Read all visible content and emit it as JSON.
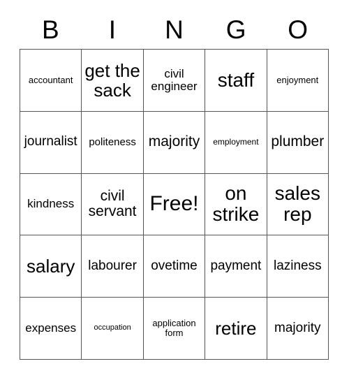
{
  "header": {
    "letters": [
      "B",
      "I",
      "N",
      "G",
      "O"
    ]
  },
  "grid": {
    "columns": 5,
    "rows": 5,
    "free_space_label": "Free!",
    "cells": [
      {
        "text": "accountant",
        "size": "fs-smp"
      },
      {
        "text": "get the sack",
        "size": "fs-4xl"
      },
      {
        "text": "civil engineer",
        "size": "fs-lg"
      },
      {
        "text": "staff",
        "size": "fs-5xl"
      },
      {
        "text": "enjoyment",
        "size": "fs-smp"
      },
      {
        "text": "journalist",
        "size": "fs-xl"
      },
      {
        "text": "politeness",
        "size": "fs-md"
      },
      {
        "text": "majority",
        "size": "fs-2xl"
      },
      {
        "text": "employment",
        "size": "fs-sm"
      },
      {
        "text": "plumber",
        "size": "fs-2xl"
      },
      {
        "text": "kindness",
        "size": "fs-lg"
      },
      {
        "text": "civil servant",
        "size": "fs-2xl"
      },
      {
        "text": "Free!",
        "size": "fs-6xl"
      },
      {
        "text": "on strike",
        "size": "fs-5xl"
      },
      {
        "text": "sales rep",
        "size": "fs-5xl"
      },
      {
        "text": "salary",
        "size": "fs-4xl"
      },
      {
        "text": "labourer",
        "size": "fs-xl"
      },
      {
        "text": "ovetime",
        "size": "fs-xl"
      },
      {
        "text": "payment",
        "size": "fs-xl"
      },
      {
        "text": "laziness",
        "size": "fs-xl"
      },
      {
        "text": "expenses",
        "size": "fs-lg"
      },
      {
        "text": "occupation",
        "size": "fs-xs"
      },
      {
        "text": "application form",
        "size": "fs-smp"
      },
      {
        "text": "retire",
        "size": "fs-4xl"
      },
      {
        "text": "majority",
        "size": "fs-xl"
      }
    ]
  },
  "colors": {
    "background": "#ffffff",
    "text": "#000000",
    "border": "#555555"
  }
}
